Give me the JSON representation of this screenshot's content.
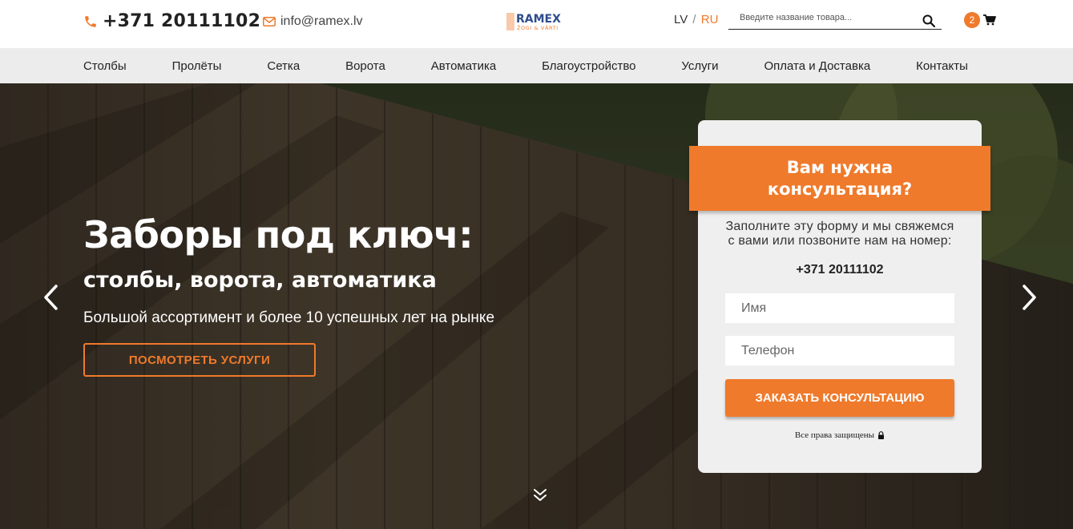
{
  "header": {
    "phone": "+371 20111102",
    "email": "info@ramex.lv",
    "logo_text": "RAMEX",
    "logo_subtext": "ŽOGI & VĀRTI",
    "lang_lv": "LV",
    "lang_sep": "/",
    "lang_ru": "RU",
    "search_placeholder": "Введите название товара...",
    "cart_count": "2",
    "icons": {
      "phone": "phone-icon",
      "email": "envelope-icon",
      "search": "search-icon",
      "cart": "cart-icon"
    }
  },
  "nav": {
    "items": [
      {
        "label": "Столбы"
      },
      {
        "label": "Пролёты"
      },
      {
        "label": "Сетка"
      },
      {
        "label": "Ворота"
      },
      {
        "label": "Автоматика"
      },
      {
        "label": "Благоустройство"
      },
      {
        "label": "Услуги"
      },
      {
        "label": "Оплата и Доставка"
      },
      {
        "label": "Контакты"
      }
    ]
  },
  "hero": {
    "title": "Заборы под ключ:",
    "subtitle": "столбы, ворота, автоматика",
    "description": "Большой ассортимент и более 10 успешных лет на рынке",
    "button_label": "ПОСМОТРЕТЬ УСЛУГИ"
  },
  "form": {
    "banner_title": "Вам нужна консультация?",
    "text": "Заполните эту форму и мы свяжемся с вами или позвоните нам на номер:",
    "phone": "+371 20111102",
    "name_placeholder": "Имя",
    "phone_placeholder": "Телефон",
    "submit_label": "ЗАКАЗАТЬ КОНСУЛЬТАЦИЮ",
    "rights": "Все права защищены"
  },
  "colors": {
    "accent": "#ef7a2b",
    "nav_bg": "#ececec",
    "form_bg": "#efefef",
    "logo_blue": "#2e4d8c"
  }
}
